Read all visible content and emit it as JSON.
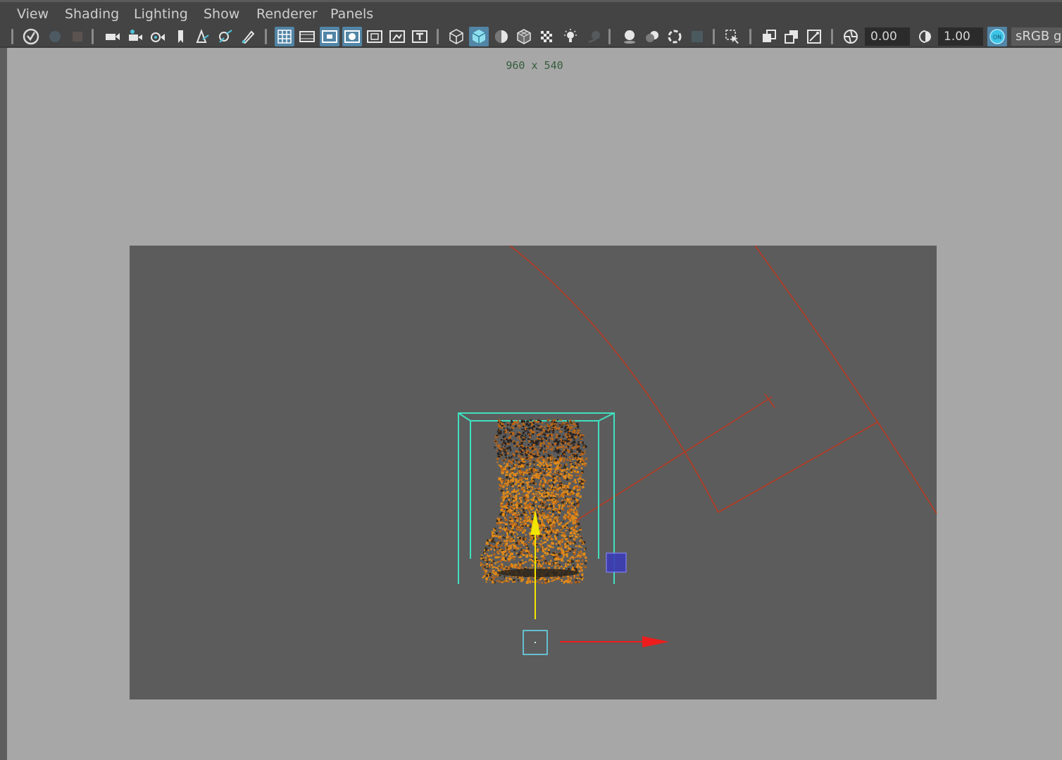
{
  "menu": [
    "View",
    "Shading",
    "Lighting",
    "Show",
    "Renderer",
    "Panels"
  ],
  "toolbar": {
    "exposure_value": "0.00",
    "gamma_value": "1.00",
    "color_management_badge": "ON",
    "color_space": "sRGB g",
    "icons": [
      "select-camera-icon",
      "camera-attributes-icon",
      "bookmark-icon",
      "camera-icon",
      "track-camera-icon",
      "dolly-camera-icon",
      "image-plane-icon",
      "2d-pan-zoom-icon",
      "grease-pencil-icon",
      "paint-icon",
      "grid-icon",
      "film-gate-icon",
      "resolution-gate-icon",
      "gate-mask-icon",
      "field-chart-icon",
      "safe-action-icon",
      "safe-title-icon",
      "wireframe-icon",
      "smooth-shade-icon",
      "default-material-icon",
      "wireframe-on-shaded-icon",
      "textured-icon",
      "use-all-lights-icon",
      "shadows-icon",
      "screen-space-ao-icon",
      "motion-blur-icon",
      "multisample-aa-icon",
      "depth-of-field-icon",
      "isolate-select-icon",
      "xray-icon",
      "xray-active-components-icon",
      "xray-joints-icon",
      "exposure-icon",
      "gamma-icon",
      "view-transform-icon"
    ]
  },
  "viewport": {
    "resolution_label": "960 x 540",
    "background_color": "#a7a7a7",
    "resolution_gate_color": "#5c5c5c",
    "fluid_container_color": "#3fe0c0",
    "fire_color": "#e08a1a",
    "light_color": "#b83a22",
    "y_axis_color": "#f2e600",
    "x_axis_color": "#ee1c1c"
  }
}
